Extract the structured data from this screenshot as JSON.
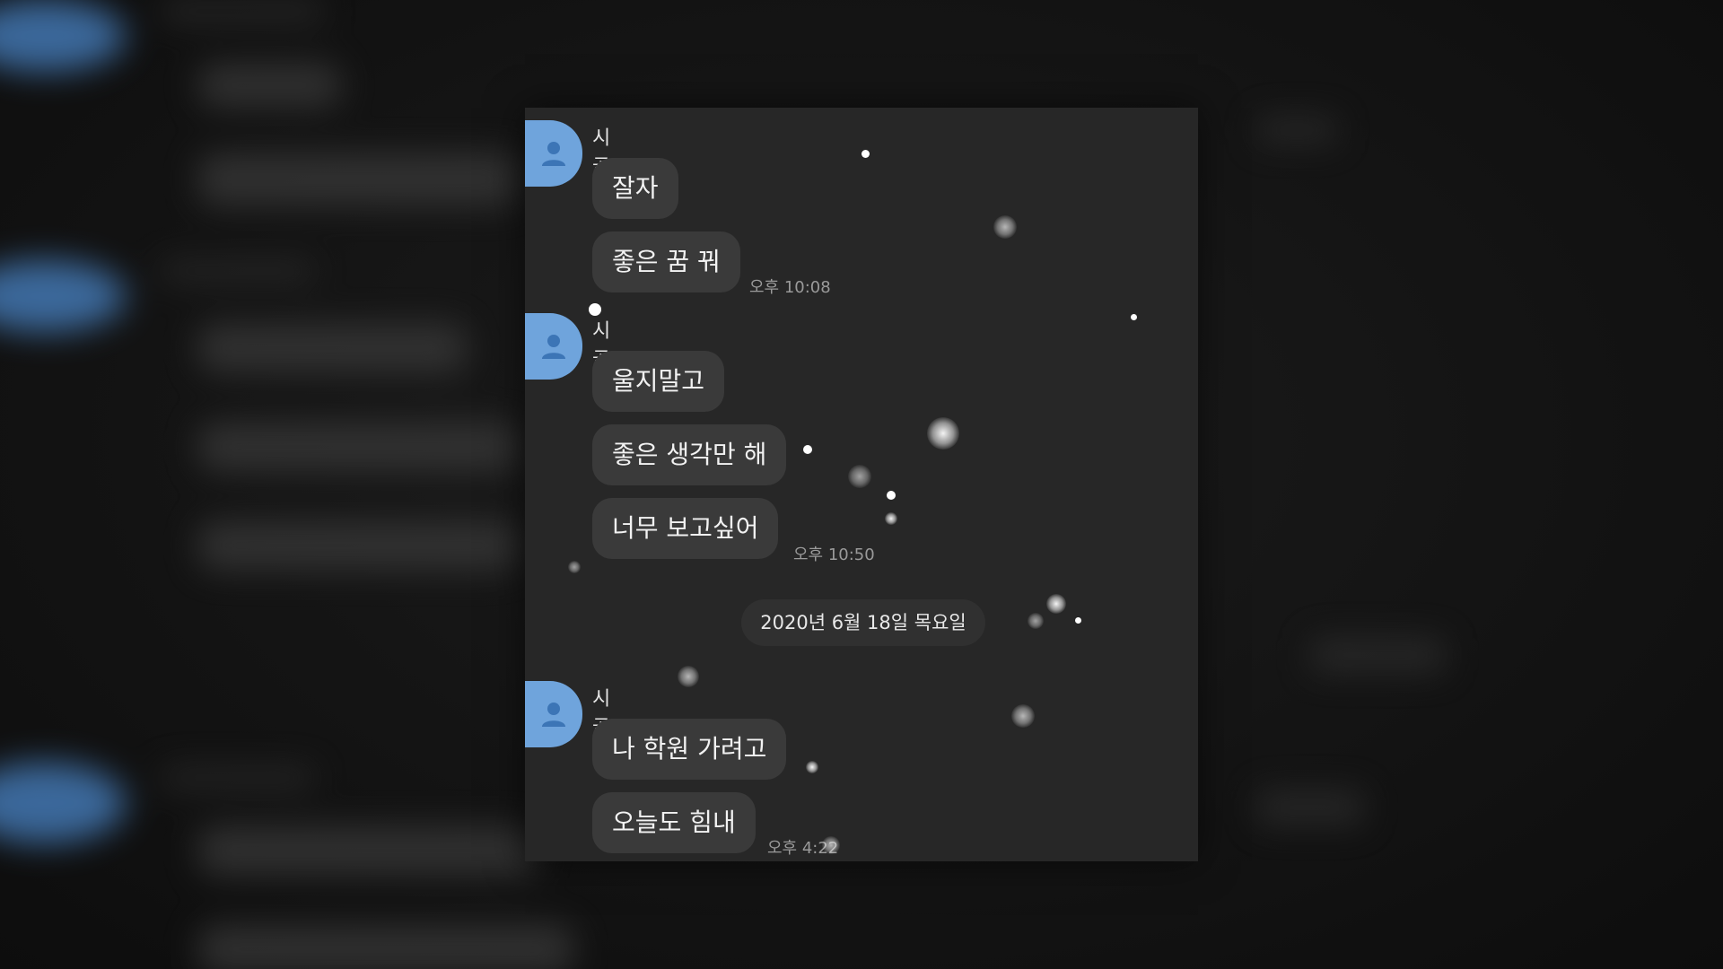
{
  "chat": {
    "date_divider": "2020년 6월 18일 목요일",
    "groups": [
      {
        "sender": "시골쥐",
        "messages": [
          "잘자",
          "좋은 꿈 꿔"
        ],
        "time": "오후 10:08"
      },
      {
        "sender": "시골쥐",
        "messages": [
          "울지말고",
          "좋은 생각만 해",
          "너무 보고싶어"
        ],
        "time": "오후 10:50"
      },
      {
        "sender": "시골쥐",
        "messages": [
          "나 학원 가려고",
          "오늘도 힘내"
        ],
        "time": "오후 4:22"
      }
    ]
  },
  "colors": {
    "avatar": "#6fa4dc",
    "bubble": "#3a3a3a",
    "panel": "#272727"
  },
  "icons": {
    "avatar": "person-icon"
  }
}
